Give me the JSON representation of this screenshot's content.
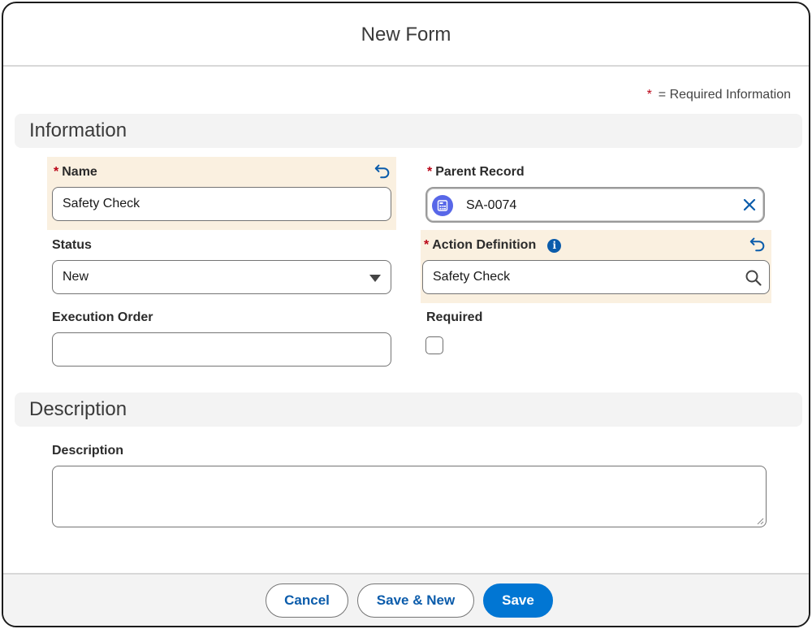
{
  "modal": {
    "title": "New Form"
  },
  "legend": {
    "star": "*",
    "text": "= Required Information"
  },
  "sections": {
    "information": "Information",
    "description": "Description"
  },
  "fields": {
    "name": {
      "label": "Name",
      "required": true,
      "value": "Safety Check"
    },
    "parent_record": {
      "label": "Parent Record",
      "required": true,
      "value": "SA-0074",
      "icon": "record-icon"
    },
    "status": {
      "label": "Status",
      "value": "New",
      "options_visible": [
        "New"
      ]
    },
    "action_definition": {
      "label": "Action Definition",
      "required": true,
      "value": "Safety Check",
      "info_glyph": "i"
    },
    "execution_order": {
      "label": "Execution Order",
      "value": ""
    },
    "required": {
      "label": "Required",
      "checked": false
    },
    "description": {
      "label": "Description",
      "value": ""
    }
  },
  "footer": {
    "cancel_label": "Cancel",
    "save_new_label": "Save & New",
    "save_label": "Save"
  },
  "colors": {
    "brand": "#0176d3",
    "link": "#0b5cab",
    "required_star": "#ba0517",
    "edited_bg": "#faf0e0",
    "section_bg": "#f3f3f3",
    "record_icon_bg": "#5867e8"
  }
}
